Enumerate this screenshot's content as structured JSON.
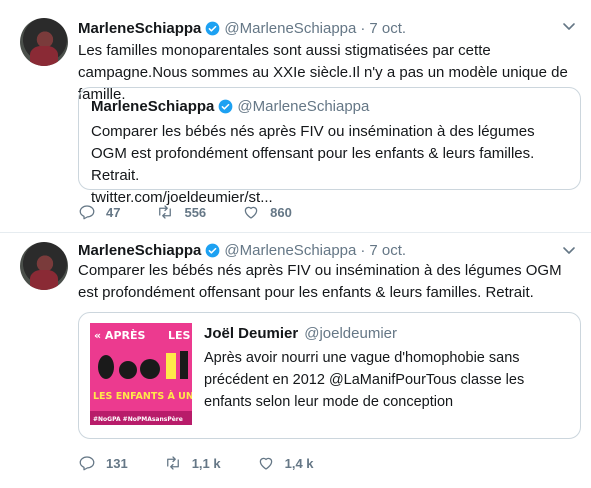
{
  "colors": {
    "text": "#14171a",
    "muted": "#657786",
    "verified": "#1da1f2",
    "border": "#ccd6dd",
    "thumb_bg": "#ec3a8f"
  },
  "tweets": [
    {
      "name": "MarleneSchiappa",
      "handle": "@MarleneSchiappa",
      "dot": "·",
      "time": "7 oct.",
      "text": "Les familles monoparentales sont aussi stigmatisées par cette campagne.Nous sommes au XXIe siècle.Il n'y a pas un modèle unique de famille.",
      "quote": {
        "name": "MarleneSchiappa",
        "handle": "@MarleneSchiappa",
        "text": "Comparer les bébés nés après FIV ou insémination à des légumes OGM est profondément offensant pour les enfants & leurs familles. Retrait.",
        "link": "twitter.com/joeldeumier/st..."
      },
      "replies": "47",
      "retweets": "556",
      "likes": "860"
    },
    {
      "name": "MarleneSchiappa",
      "handle": "@MarleneSchiappa",
      "dot": "·",
      "time": "7 oct.",
      "text": "Comparer les bébés nés après FIV ou insémination à des légumes OGM est profondément offensant pour les enfants & leurs familles. Retrait.",
      "quote": {
        "name": "Joël Deumier",
        "handle": "@joeldeumier",
        "text": "Après avoir nourri une vague d'homophobie sans précédent en 2012 @LaManifPourTous classe les  enfants selon leur mode de conception",
        "thumb": {
          "top_left": "« APRÈS",
          "top_right": "LES",
          "middle": "LES ENFANTS À UN",
          "bottom": "#NoGPA  #NoPMAsansPère"
        }
      },
      "replies": "131",
      "retweets": "1,1 k",
      "likes": "1,4 k"
    }
  ]
}
